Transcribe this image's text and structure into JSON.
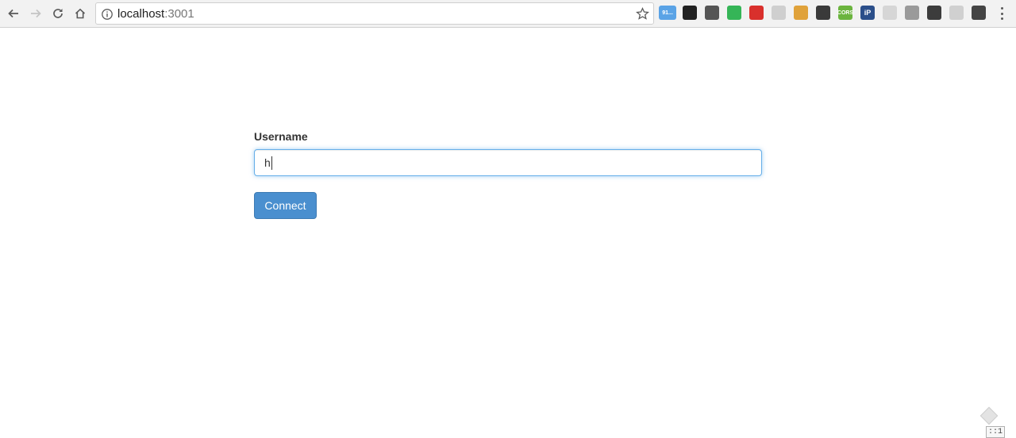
{
  "browser": {
    "url_host": "localhost",
    "url_port": ":3001",
    "extensions": [
      {
        "icon": "weather-extension-icon",
        "text": "91...",
        "color": "#5aa3e6"
      },
      {
        "icon": "qr-code-extension-icon",
        "text": "",
        "color": "#222222"
      },
      {
        "icon": "bug-extension-icon",
        "text": "",
        "color": "#555555"
      },
      {
        "icon": "green-diamond-extension-icon",
        "text": "",
        "color": "#35b557"
      },
      {
        "icon": "red-circle-extension-icon",
        "text": "",
        "color": "#d9302c"
      },
      {
        "icon": "grey-leaf-extension-icon",
        "text": "",
        "color": "#cfcfcf"
      },
      {
        "icon": "brush-extension-icon",
        "text": "",
        "color": "#e0a23a"
      },
      {
        "icon": "dark-badge-extension-icon",
        "text": "",
        "color": "#3a3a3a"
      },
      {
        "icon": "cors-extension-icon",
        "text": "CORS",
        "color": "#6bb43e"
      },
      {
        "icon": "ip-extension-icon",
        "text": "iP",
        "color": "#2b4f8a"
      },
      {
        "icon": "grey-a-extension-icon",
        "text": "",
        "color": "#d6d6d6"
      },
      {
        "icon": "globe-extension-icon",
        "text": "",
        "color": "#9a9a9a"
      },
      {
        "icon": "evernote-extension-icon",
        "text": "",
        "color": "#3c3c3c"
      },
      {
        "icon": "grid-extension-icon",
        "text": "",
        "color": "#d0d0d0"
      },
      {
        "icon": "sync-extension-icon",
        "text": "",
        "color": "#444444"
      }
    ]
  },
  "form": {
    "username_label": "Username",
    "username_value": "h",
    "connect_label": "Connect"
  },
  "corner": {
    "badge_text": "::1"
  }
}
